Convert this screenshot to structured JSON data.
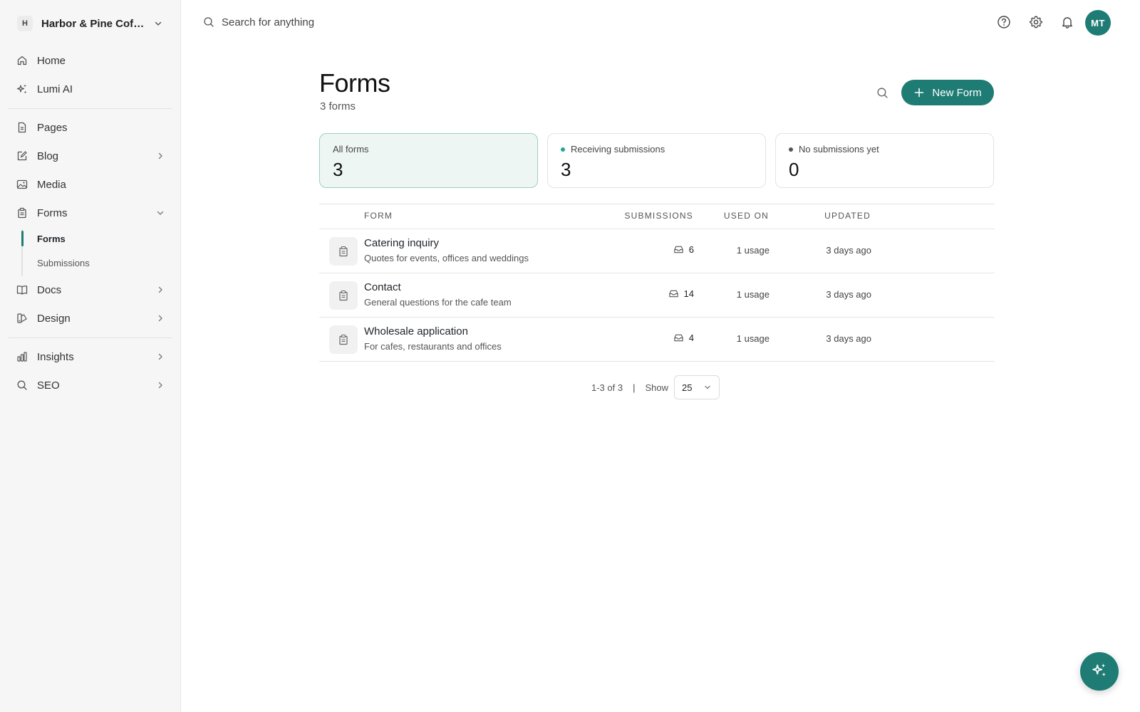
{
  "workspace": {
    "badge": "H",
    "name": "Harbor & Pine Coffee"
  },
  "sidebar": {
    "items": [
      {
        "label": "Home"
      },
      {
        "label": "Lumi AI"
      },
      {
        "label": "Pages"
      },
      {
        "label": "Blog"
      },
      {
        "label": "Media"
      },
      {
        "label": "Forms"
      },
      {
        "label": "Docs"
      },
      {
        "label": "Design"
      },
      {
        "label": "Insights"
      },
      {
        "label": "SEO"
      }
    ],
    "forms_sub": [
      {
        "label": "Forms",
        "active": true
      },
      {
        "label": "Submissions",
        "active": false
      }
    ]
  },
  "topbar": {
    "search_placeholder": "Search for anything",
    "avatar_initials": "MT"
  },
  "page": {
    "title": "Forms",
    "subtitle": "3 forms",
    "new_button": "New Form"
  },
  "stats": [
    {
      "label": "All forms",
      "value": "3",
      "dot_color": ""
    },
    {
      "label": "Receiving submissions",
      "value": "3",
      "dot_color": "#22a593"
    },
    {
      "label": "No submissions yet",
      "value": "0",
      "dot_color": "#555555"
    }
  ],
  "table": {
    "headers": {
      "form": "FORM",
      "submissions": "SUBMISSIONS",
      "used_on": "USED ON",
      "updated": "UPDATED"
    },
    "rows": [
      {
        "title": "Catering inquiry",
        "description": "Quotes for events, offices and weddings",
        "submissions": "6",
        "used_on": "1 usage",
        "updated": "3 days ago"
      },
      {
        "title": "Contact",
        "description": "General questions for the cafe team",
        "submissions": "14",
        "used_on": "1 usage",
        "updated": "3 days ago"
      },
      {
        "title": "Wholesale application",
        "description": "For cafes, restaurants and offices",
        "submissions": "4",
        "used_on": "1 usage",
        "updated": "3 days ago"
      }
    ]
  },
  "pagination": {
    "range": "1-3 of 3",
    "separator": "|",
    "show_label": "Show",
    "page_size": "25"
  },
  "colors": {
    "accent": "#1e7c74",
    "sidebar_bg": "#f6f6f6",
    "active_card_bg": "#eef6f4"
  }
}
